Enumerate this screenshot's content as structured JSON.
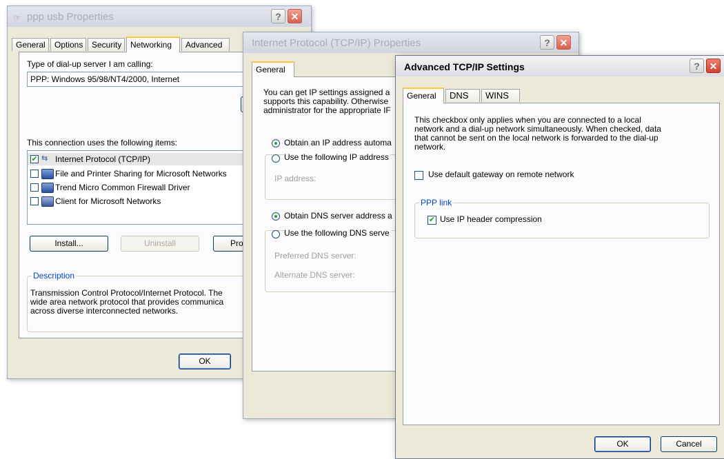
{
  "win1": {
    "title": "ppp usb Properties",
    "tabs": [
      "General",
      "Options",
      "Security",
      "Networking",
      "Advanced"
    ],
    "server_label": "Type of dial-up server I am calling:",
    "server_value": "PPP: Windows 95/98/NT4/2000, Internet",
    "items_label": "This connection uses the following items:",
    "items": [
      {
        "label": "Internet Protocol (TCP/IP)",
        "checked": true,
        "icon": "protocol-icon"
      },
      {
        "label": "File and Printer Sharing for Microsoft Networks",
        "checked": false,
        "icon": "network-service-icon"
      },
      {
        "label": "Trend Micro Common Firewall Driver",
        "checked": false,
        "icon": "network-service-icon"
      },
      {
        "label": "Client for Microsoft Networks",
        "checked": false,
        "icon": "network-client-icon"
      }
    ],
    "install_label": "Install...",
    "uninstall_label": "Uninstall",
    "properties_label": "Pro",
    "description_legend": "Description",
    "description_lines": [
      "Transmission Control Protocol/Internet Protocol. The",
      "wide area network protocol that provides communica",
      "across diverse interconnected networks."
    ],
    "ok_label": "OK"
  },
  "win2": {
    "title": "Internet Protocol (TCP/IP) Properties",
    "tab": "General",
    "intro_lines": [
      "You can get IP settings assigned a",
      "supports this capability. Otherwise",
      "administrator for the appropriate IF"
    ],
    "radio_auto_ip": "Obtain an IP address automa",
    "radio_manual_ip": "Use the following IP address",
    "ip_label": "IP address:",
    "radio_auto_dns": "Obtain DNS server address a",
    "radio_manual_dns": "Use the following DNS serve",
    "preferred_dns": "Preferred DNS server:",
    "alternate_dns": "Alternate DNS server:"
  },
  "win3": {
    "title": "Advanced TCP/IP Settings",
    "tabs": [
      "General",
      "DNS",
      "WINS"
    ],
    "info_lines": [
      "This checkbox only applies when you are connected to a local",
      "network and a dial-up network simultaneously.  When checked, data",
      "that cannot be sent on the local network is forwarded to the dial-up",
      "network."
    ],
    "gateway_label": "Use default gateway on remote network",
    "gateway_checked": false,
    "ppp_legend": "PPP link",
    "compression_label": "Use IP header compression",
    "compression_checked": true,
    "ok_label": "OK",
    "cancel_label": "Cancel"
  },
  "colors": {
    "dialog_bg": "#ece9d8",
    "panel_bg": "#fcfcfe",
    "tab_highlight": "#ffc83c",
    "close_button": "#d04030",
    "check_green": "#21a121",
    "legend_blue": "#0046d5"
  }
}
